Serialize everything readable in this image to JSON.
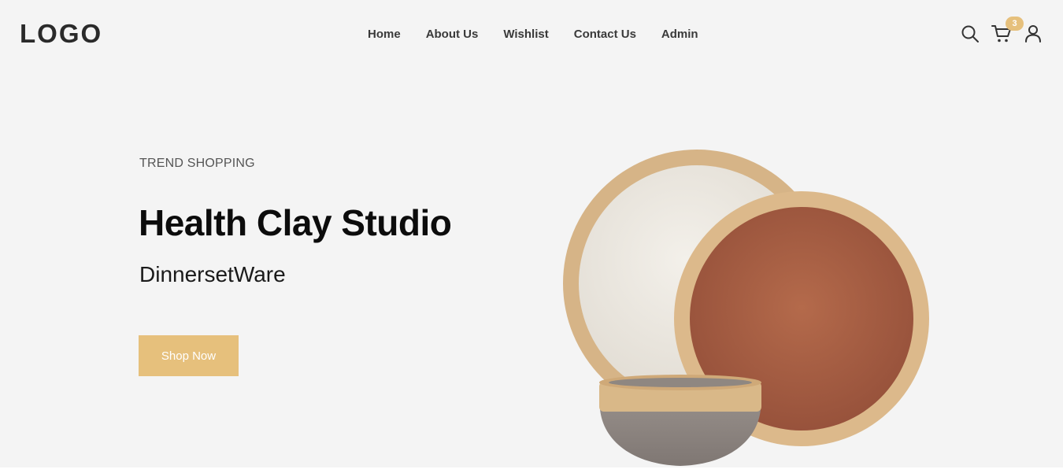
{
  "header": {
    "logo": "LOGO",
    "nav": [
      {
        "label": "Home"
      },
      {
        "label": "About Us"
      },
      {
        "label": "Wishlist"
      },
      {
        "label": "Contact Us"
      },
      {
        "label": "Admin"
      }
    ],
    "icons": [
      "search-icon",
      "cart-icon",
      "user-icon"
    ],
    "cart_count": "3"
  },
  "hero": {
    "eyebrow": "TREND SHOPPING",
    "title": "Health Clay Studio",
    "subtitle": "DinnersetWare",
    "cta_label": "Shop Now",
    "image": "dinnerware-plates-and-bowl"
  },
  "colors": {
    "accent": "#e6c07c",
    "background": "#f4f4f4",
    "text_dark": "#0c0c0c",
    "plate_rim": "#d9b888",
    "plate_white": "#ece8e1",
    "plate_terracotta": "#a85e42",
    "bowl_gray": "#928a85"
  }
}
